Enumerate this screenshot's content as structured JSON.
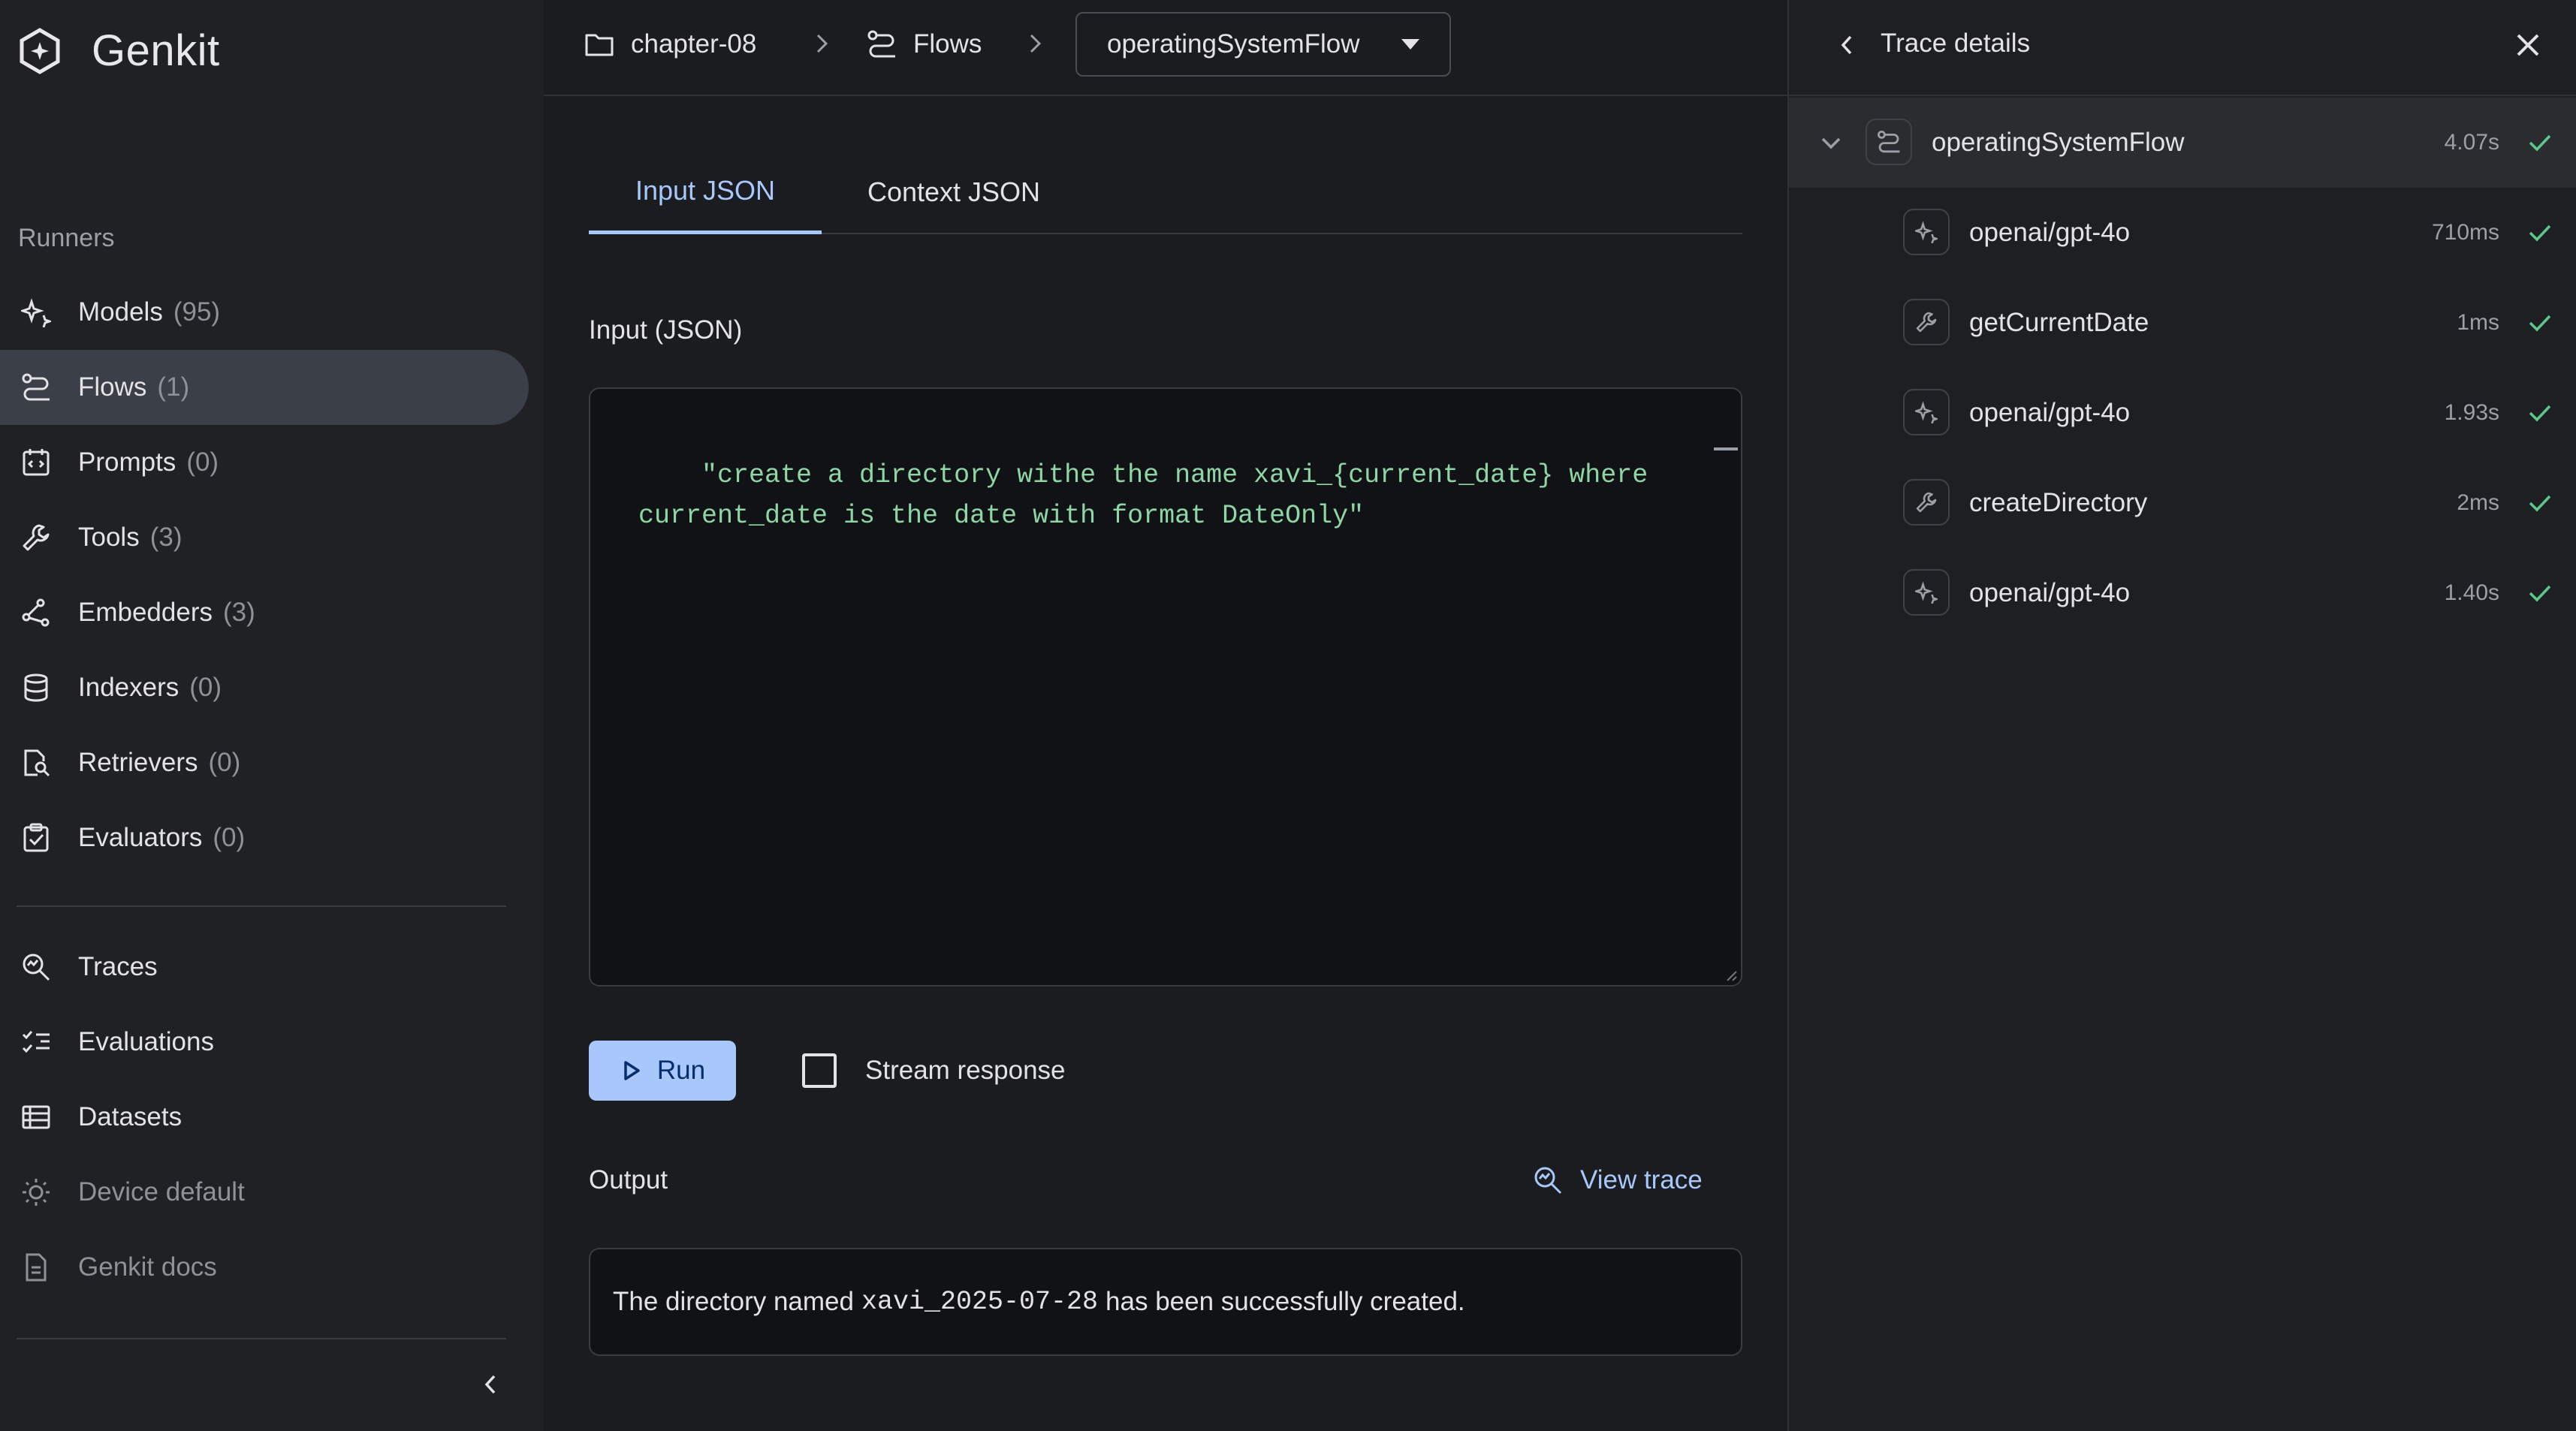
{
  "app": {
    "name": "Genkit"
  },
  "sidebar": {
    "section_title": "Runners",
    "runners": [
      {
        "label": "Models",
        "count": "(95)"
      },
      {
        "label": "Flows",
        "count": "(1)"
      },
      {
        "label": "Prompts",
        "count": "(0)"
      },
      {
        "label": "Tools",
        "count": "(3)"
      },
      {
        "label": "Embedders",
        "count": "(3)"
      },
      {
        "label": "Indexers",
        "count": "(0)"
      },
      {
        "label": "Retrievers",
        "count": "(0)"
      },
      {
        "label": "Evaluators",
        "count": "(0)"
      }
    ],
    "links": [
      {
        "label": "Traces"
      },
      {
        "label": "Evaluations"
      },
      {
        "label": "Datasets"
      },
      {
        "label": "Device default"
      },
      {
        "label": "Genkit docs"
      }
    ]
  },
  "breadcrumb": {
    "project": "chapter-08",
    "section": "Flows",
    "selected_flow": "operatingSystemFlow"
  },
  "main": {
    "tabs": [
      {
        "label": "Input JSON"
      },
      {
        "label": "Context JSON"
      }
    ],
    "input_label": "Input (JSON)",
    "input_value": "\"create a directory withe the name xavi_{current_date} where\ncurrent_date is the date with format DateOnly\"",
    "run_label": "Run",
    "stream_label": "Stream response",
    "output_label": "Output",
    "view_trace_label": "View trace",
    "output": {
      "prefix": "The directory named",
      "code": "xavi_2025-07-28",
      "suffix": "has been successfully created."
    }
  },
  "trace": {
    "title": "Trace details",
    "spans": [
      {
        "name": "operatingSystemFlow",
        "duration": "4.07s",
        "kind": "flow-icon"
      },
      {
        "name": "openai/gpt-4o",
        "duration": "710ms",
        "kind": "model-icon"
      },
      {
        "name": "getCurrentDate",
        "duration": "1ms",
        "kind": "tool-icon"
      },
      {
        "name": "openai/gpt-4o",
        "duration": "1.93s",
        "kind": "model-icon"
      },
      {
        "name": "createDirectory",
        "duration": "2ms",
        "kind": "tool-icon"
      },
      {
        "name": "openai/gpt-4o",
        "duration": "1.40s",
        "kind": "model-icon"
      }
    ]
  },
  "colors": {
    "accent": "#a8c7fa",
    "success": "#5fc78a",
    "code": "#8fd6a6"
  }
}
